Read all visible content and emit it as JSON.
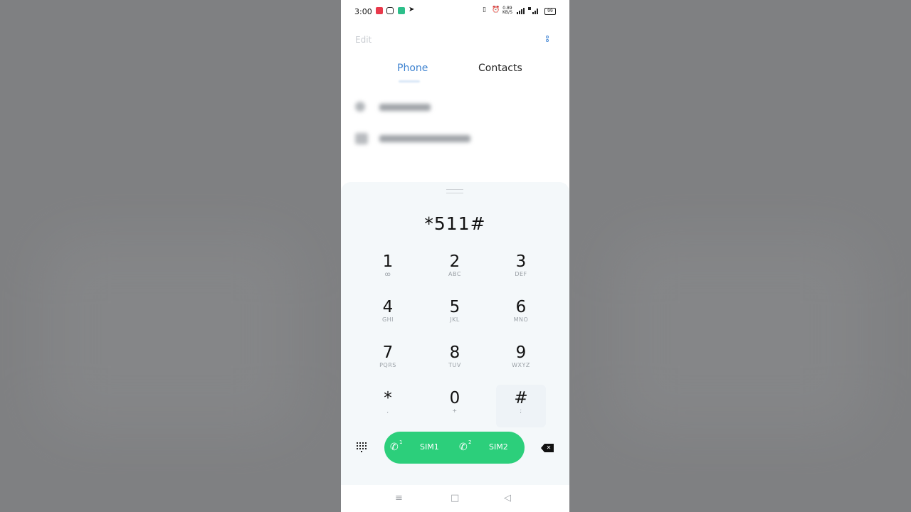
{
  "status_bar": {
    "time": "3:00",
    "net_speed_value": "0.89",
    "net_speed_unit": "KB/S",
    "battery": "99",
    "icons": [
      "app-red-icon",
      "instagram-icon",
      "green-chat-icon",
      "telegram-icon",
      "vibrate-icon",
      "alarm-icon",
      "signal-icon",
      "signal-4g-icon",
      "battery-icon"
    ]
  },
  "header": {
    "edit_label": "Edit",
    "more_icon": "more-vertical-icon"
  },
  "tabs": [
    {
      "label": "Phone",
      "active": true
    },
    {
      "label": "Contacts",
      "active": false
    }
  ],
  "dialer": {
    "number": "*511#",
    "keys": [
      {
        "digit": "1",
        "sub": "ꝏ"
      },
      {
        "digit": "2",
        "sub": "ABC"
      },
      {
        "digit": "3",
        "sub": "DEF"
      },
      {
        "digit": "4",
        "sub": "GHI"
      },
      {
        "digit": "5",
        "sub": "JKL"
      },
      {
        "digit": "6",
        "sub": "MNO"
      },
      {
        "digit": "7",
        "sub": "PQRS"
      },
      {
        "digit": "8",
        "sub": "TUV"
      },
      {
        "digit": "9",
        "sub": "WXYZ"
      },
      {
        "digit": "*",
        "sub": ","
      },
      {
        "digit": "0",
        "sub": "+"
      },
      {
        "digit": "#",
        "sub": ";"
      }
    ],
    "sim1_num": "1",
    "sim1_label": "SIM1",
    "sim2_num": "2",
    "sim2_label": "SIM2"
  },
  "colors": {
    "accent": "#3f83d0",
    "call_green": "#2ccf7b",
    "sheet_bg": "#f4f8fa"
  },
  "nav": {
    "menu": "≡",
    "home": "□",
    "back": "◁"
  }
}
